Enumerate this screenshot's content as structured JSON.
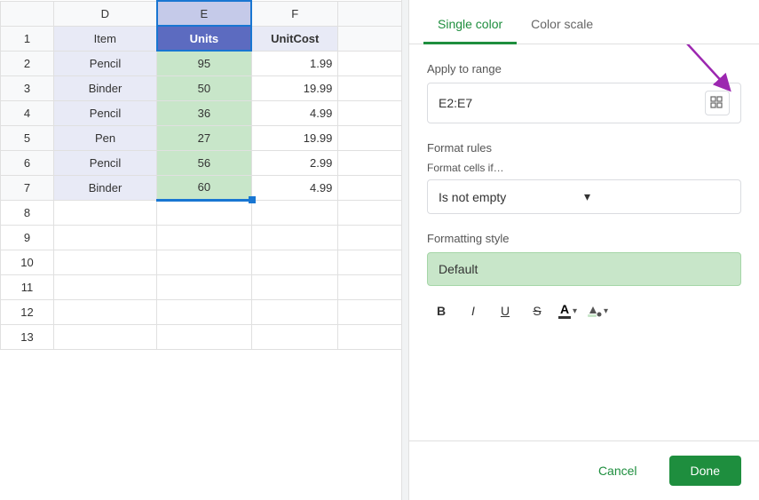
{
  "tabs": {
    "single_color": "Single color",
    "color_scale": "Color scale",
    "active": "single_color"
  },
  "panel": {
    "apply_to_range_label": "Apply to range",
    "range_value": "E2:E7",
    "format_rules_label": "Format rules",
    "format_if_label": "Format cells if…",
    "format_condition": "Is not empty",
    "formatting_style_label": "Formatting style",
    "default_label": "Default"
  },
  "toolbar": {
    "bold": "B",
    "italic": "I",
    "underline": "U",
    "strikethrough": "S",
    "font_color": "A",
    "fill_color": "⬜",
    "chevron": "▾"
  },
  "buttons": {
    "cancel": "Cancel",
    "done": "Done"
  },
  "spreadsheet": {
    "columns": [
      "D",
      "E",
      "F"
    ],
    "headers": [
      "Item",
      "Units",
      "UnitCost"
    ],
    "rows": [
      {
        "item": "Pencil",
        "units": "95",
        "unitcost": "1.99"
      },
      {
        "item": "Binder",
        "units": "50",
        "unitcost": "19.99"
      },
      {
        "item": "Pencil",
        "units": "36",
        "unitcost": "4.99"
      },
      {
        "item": "Pen",
        "units": "27",
        "unitcost": "19.99"
      },
      {
        "item": "Pencil",
        "units": "56",
        "unitcost": "2.99"
      },
      {
        "item": "Binder",
        "units": "60",
        "unitcost": "4.99"
      }
    ]
  }
}
